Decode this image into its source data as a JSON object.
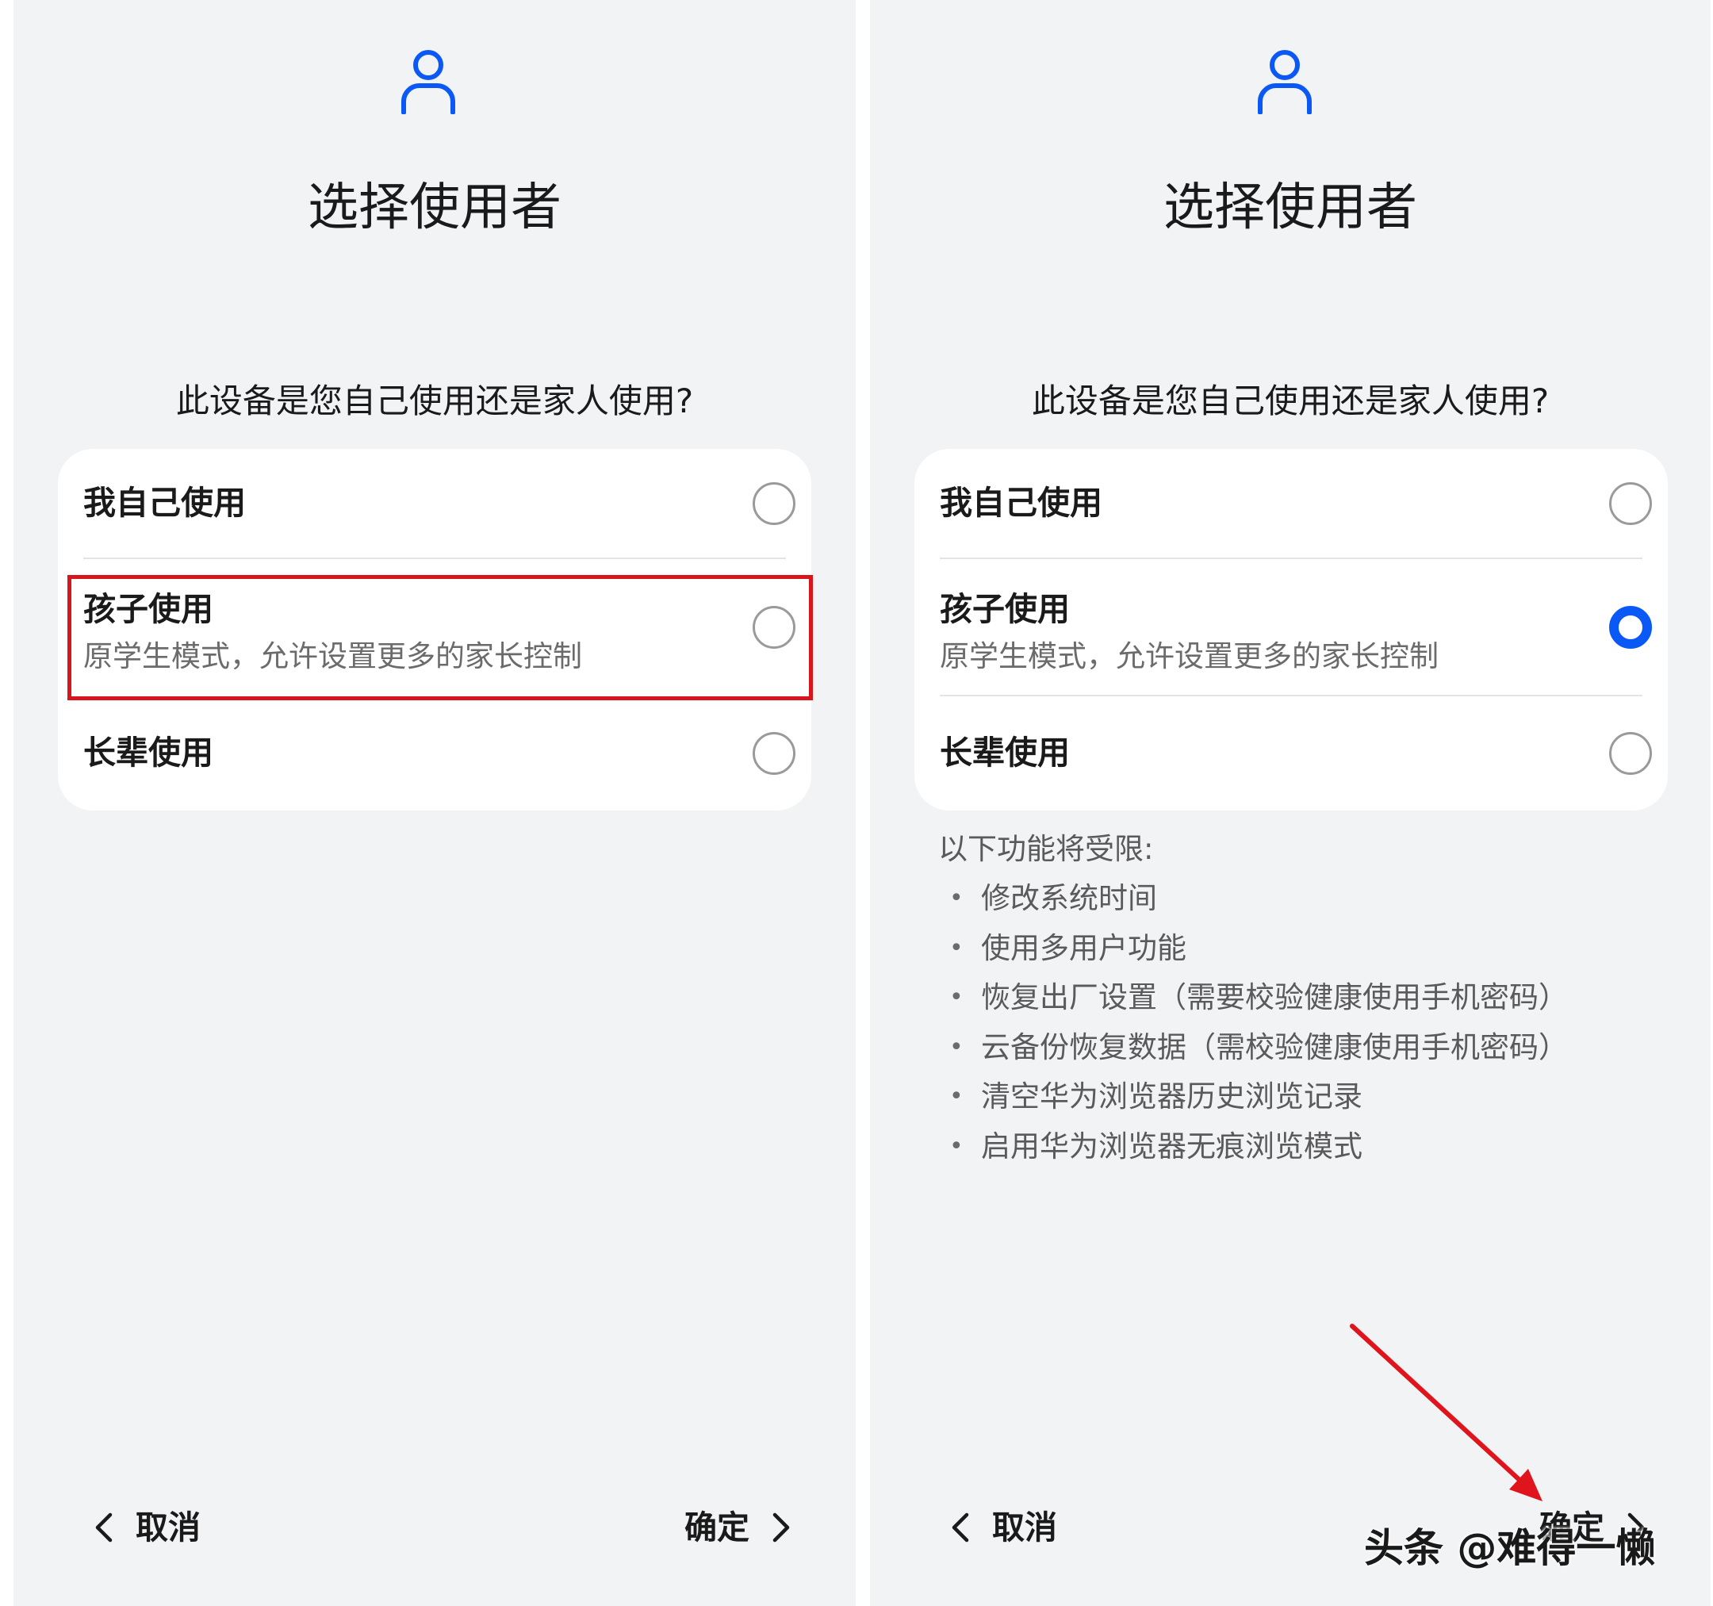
{
  "left": {
    "title": "选择使用者",
    "question": "此设备是您自己使用还是家人使用?",
    "options": [
      {
        "label": "我自己使用",
        "sub": "",
        "selected": false
      },
      {
        "label": "孩子使用",
        "sub": "原学生模式，允许设置更多的家长控制",
        "selected": false,
        "highlighted": true
      },
      {
        "label": "长辈使用",
        "sub": "",
        "selected": false
      }
    ],
    "cancel_label": "取消",
    "confirm_label": "确定"
  },
  "right": {
    "title": "选择使用者",
    "question": "此设备是您自己使用还是家人使用?",
    "options": [
      {
        "label": "我自己使用",
        "sub": "",
        "selected": false
      },
      {
        "label": "孩子使用",
        "sub": "原学生模式，允许设置更多的家长控制",
        "selected": true
      },
      {
        "label": "长辈使用",
        "sub": "",
        "selected": false
      }
    ],
    "restrictions_title": "以下功能将受限:",
    "restrictions": [
      "修改系统时间",
      "使用多用户功能",
      "恢复出厂设置（需要校验健康使用手机密码）",
      "云备份恢复数据（需校验健康使用手机密码）",
      "清空华为浏览器历史浏览记录",
      "启用华为浏览器无痕浏览模式"
    ],
    "cancel_label": "取消",
    "confirm_label": "确定",
    "watermark": "头条 @难得一懒"
  },
  "colors": {
    "accent": "#0a59f7",
    "highlight_box": "#d8141c",
    "background": "#f1f3f5"
  },
  "icons": {
    "header": "user-icon",
    "back": "chevron-left-icon",
    "next": "chevron-right-icon"
  }
}
